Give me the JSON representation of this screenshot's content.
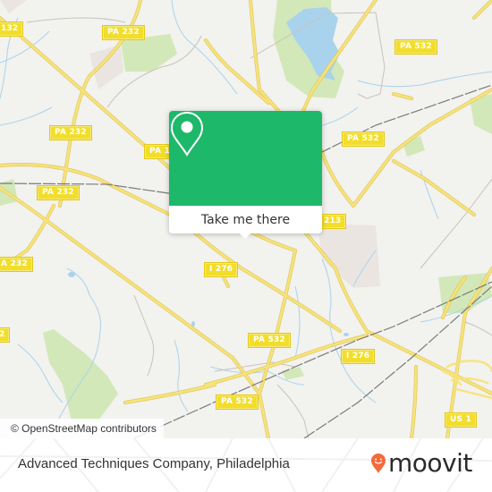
{
  "map": {
    "route_shields": [
      {
        "label": "132"
      },
      {
        "label": "PA 232"
      },
      {
        "label": "PA 232"
      },
      {
        "label": "PA 1"
      },
      {
        "label": "PA 232"
      },
      {
        "label": "PA 532"
      },
      {
        "label": "PA 532"
      },
      {
        "label": "A 232"
      },
      {
        "label": "I 276"
      },
      {
        "label": "2"
      },
      {
        "label": "213"
      },
      {
        "label": "PA 532"
      },
      {
        "label": "I 276"
      },
      {
        "label": "PA 532"
      },
      {
        "label": "US 1"
      }
    ],
    "colors": {
      "background": "#f2f2ef",
      "road": "#f7e37b",
      "road_casing": "#e0c85a",
      "water": "#a9d3ec",
      "park": "#cfe6b0",
      "railway": "#777777",
      "minor_road": "#c9c2bb"
    }
  },
  "popup": {
    "icon": "location-pin-icon",
    "button_label": "Take me there",
    "accent": "#1db86a"
  },
  "attribution": "© OpenStreetMap contributors",
  "footer": {
    "place_name": "Advanced Techniques Company, Philadelphia",
    "logo_text": "moovit",
    "logo_color": "#f26b3a"
  }
}
